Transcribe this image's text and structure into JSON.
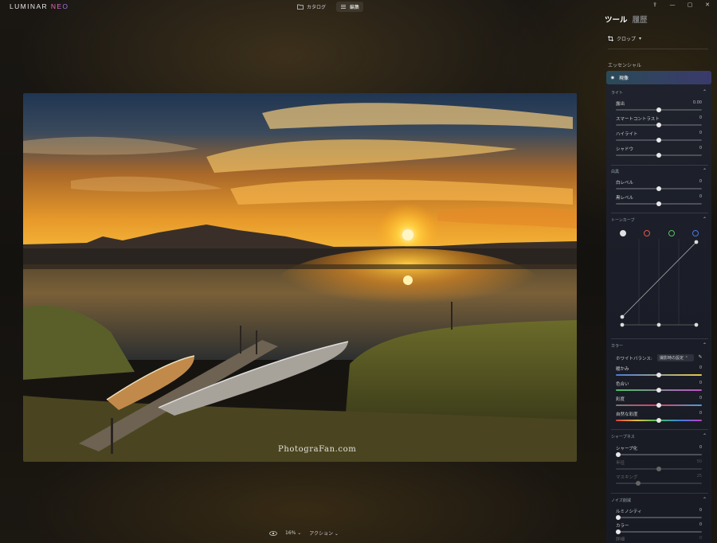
{
  "app": {
    "logo_main": "LUMINAR ",
    "logo_neo": "NEO"
  },
  "topbar": {
    "tabs": [
      {
        "label": "カタログ",
        "icon": "folder-icon"
      },
      {
        "label": "編集",
        "icon": "sliders-icon",
        "active": true
      }
    ],
    "window_controls": [
      "share-icon",
      "minimize-icon",
      "maximize-icon",
      "close-icon"
    ]
  },
  "photo": {
    "watermark": "PhotograFan.com"
  },
  "bottom": {
    "zoom": "16%",
    "actions": "アクション"
  },
  "panel": {
    "tabs": [
      {
        "label": "ツール",
        "active": true
      },
      {
        "label": "履歴",
        "active": false
      }
    ],
    "crop_label": "クロップ",
    "essentials_label": "エッセンシャル",
    "develop_label": "現像",
    "light": {
      "title": "ライト",
      "sliders": [
        {
          "label": "露出",
          "value": "0.00",
          "position": 0.5
        },
        {
          "label": "スマートコントラスト",
          "value": "0",
          "position": 0.5
        },
        {
          "label": "ハイライト",
          "value": "0",
          "position": 0.5
        },
        {
          "label": "シャドウ",
          "value": "0",
          "position": 0.5
        }
      ]
    },
    "whites": {
      "title": "白黒",
      "sliders": [
        {
          "label": "白レベル",
          "value": "0",
          "position": 0.5
        },
        {
          "label": "黒レベル",
          "value": "0",
          "position": 0.5
        }
      ]
    },
    "tone_curve": {
      "title": "トーンカーブ",
      "channels": [
        {
          "name": "luminance",
          "color": "#e0e0e0"
        },
        {
          "name": "red",
          "color": "#e05a4a"
        },
        {
          "name": "green",
          "color": "#58c060"
        },
        {
          "name": "blue",
          "color": "#4a78e0"
        }
      ]
    },
    "color": {
      "title": "カラー",
      "wb_label": "ホワイトバランス:",
      "wb_value": "撮影時の設定",
      "sliders": [
        {
          "label": "暖かみ",
          "value": "0",
          "position": 0.5
        },
        {
          "label": "色合い",
          "value": "0",
          "position": 0.5
        },
        {
          "label": "彩度",
          "value": "0",
          "position": 0.5
        },
        {
          "label": "自然な彩度",
          "value": "0",
          "position": 0.5
        }
      ]
    },
    "sharpness": {
      "title": "シャープネス",
      "sliders": [
        {
          "label": "シャープ化",
          "value": "0",
          "position": 0.03
        },
        {
          "label": "半径",
          "value": "50",
          "position": 0.5,
          "disabled": true
        },
        {
          "label": "マスキング",
          "value": "25",
          "position": 0.25,
          "disabled": true
        }
      ]
    },
    "noise": {
      "title": "ノイズ削減",
      "sliders": [
        {
          "label": "ルミノシティ",
          "value": "0",
          "position": 0.03
        },
        {
          "label": "カラー",
          "value": "0",
          "position": 0.03
        },
        {
          "label": "詳細",
          "value": "0",
          "position": 0.03
        }
      ]
    }
  }
}
